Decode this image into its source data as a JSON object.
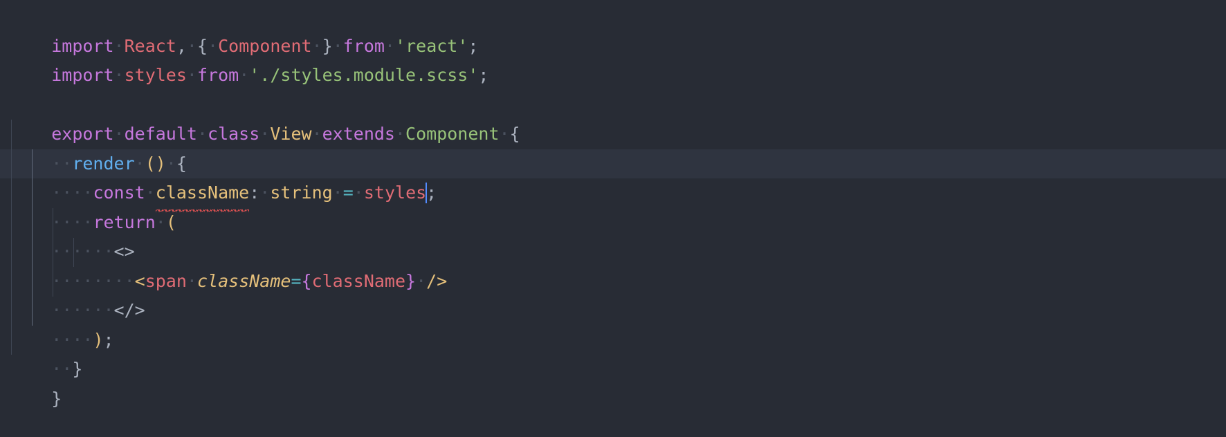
{
  "editor": {
    "language": "typescript-react",
    "background_color": "#282c35",
    "current_line_color": "#2f3440",
    "caret_color": "#528bff",
    "error_underline_color": "#e05252",
    "indent_guide_color": "#3f4654",
    "indent_guide_active_color": "#636c7d",
    "font_size_px": 25,
    "line_height_px": 42.5,
    "whitespace_dot": "·",
    "current_line_number": 5,
    "caret_after_token": "styles"
  },
  "palette": {
    "keyword": "#c678dd",
    "identifier": "#e06c75",
    "string": "#98c379",
    "type": "#e5c07b",
    "class": "#98c379",
    "function": "#61afef",
    "operator": "#56b6c2",
    "punctuation": "#abb2bf"
  },
  "code": {
    "line1": {
      "t1": "import",
      "ws1": "·",
      "t2": "React",
      "t3": ",",
      "ws2": "·",
      "t4": "{",
      "ws3": "·",
      "t5": "Component",
      "ws4": "·",
      "t6": "}",
      "ws5": "·",
      "t7": "from",
      "ws6": "·",
      "t8": "'react'",
      "t9": ";"
    },
    "line2": {
      "t1": "import",
      "ws1": "·",
      "t2": "styles",
      "ws2": "·",
      "t3": "from",
      "ws3": "·",
      "t4": "'./styles.module.scss'",
      "t5": ";"
    },
    "line3": {
      "text": ""
    },
    "line4": {
      "t1": "export",
      "ws1": "·",
      "t2": "default",
      "ws2": "·",
      "t3": "class",
      "ws3": "·",
      "t4": "View",
      "ws4": "·",
      "t5": "extends",
      "ws5": "·",
      "t6": "Component",
      "ws6": "·",
      "t7": "{"
    },
    "line5": {
      "indent": "··",
      "t1": "render",
      "ws1": "·",
      "t2": "()",
      "ws2": "·",
      "t3": "{"
    },
    "line6": {
      "indent": "····",
      "t1": "const",
      "ws1": "·",
      "t2": "className",
      "t3": ":",
      "ws2": "·",
      "t4": "string",
      "ws3": "·",
      "t5": "=",
      "ws4": "·",
      "t6": "styles",
      "t7": ";"
    },
    "line7": {
      "indent": "····",
      "t1": "return",
      "ws1": "·",
      "t2": "("
    },
    "line8": {
      "indent": "······",
      "t1": "<>"
    },
    "line9": {
      "indent": "········",
      "t1": "<",
      "t2": "span",
      "ws1": "·",
      "t3": "className",
      "t4": "=",
      "t5": "{",
      "t6": "className",
      "t7": "}",
      "ws2": "·",
      "t8": "/>"
    },
    "line10": {
      "indent": "······",
      "t1": "</>"
    },
    "line11": {
      "indent": "····",
      "t1": ")",
      "t2": ";"
    },
    "line12": {
      "indent": "··",
      "t1": "}"
    },
    "line13": {
      "t1": "}"
    }
  }
}
